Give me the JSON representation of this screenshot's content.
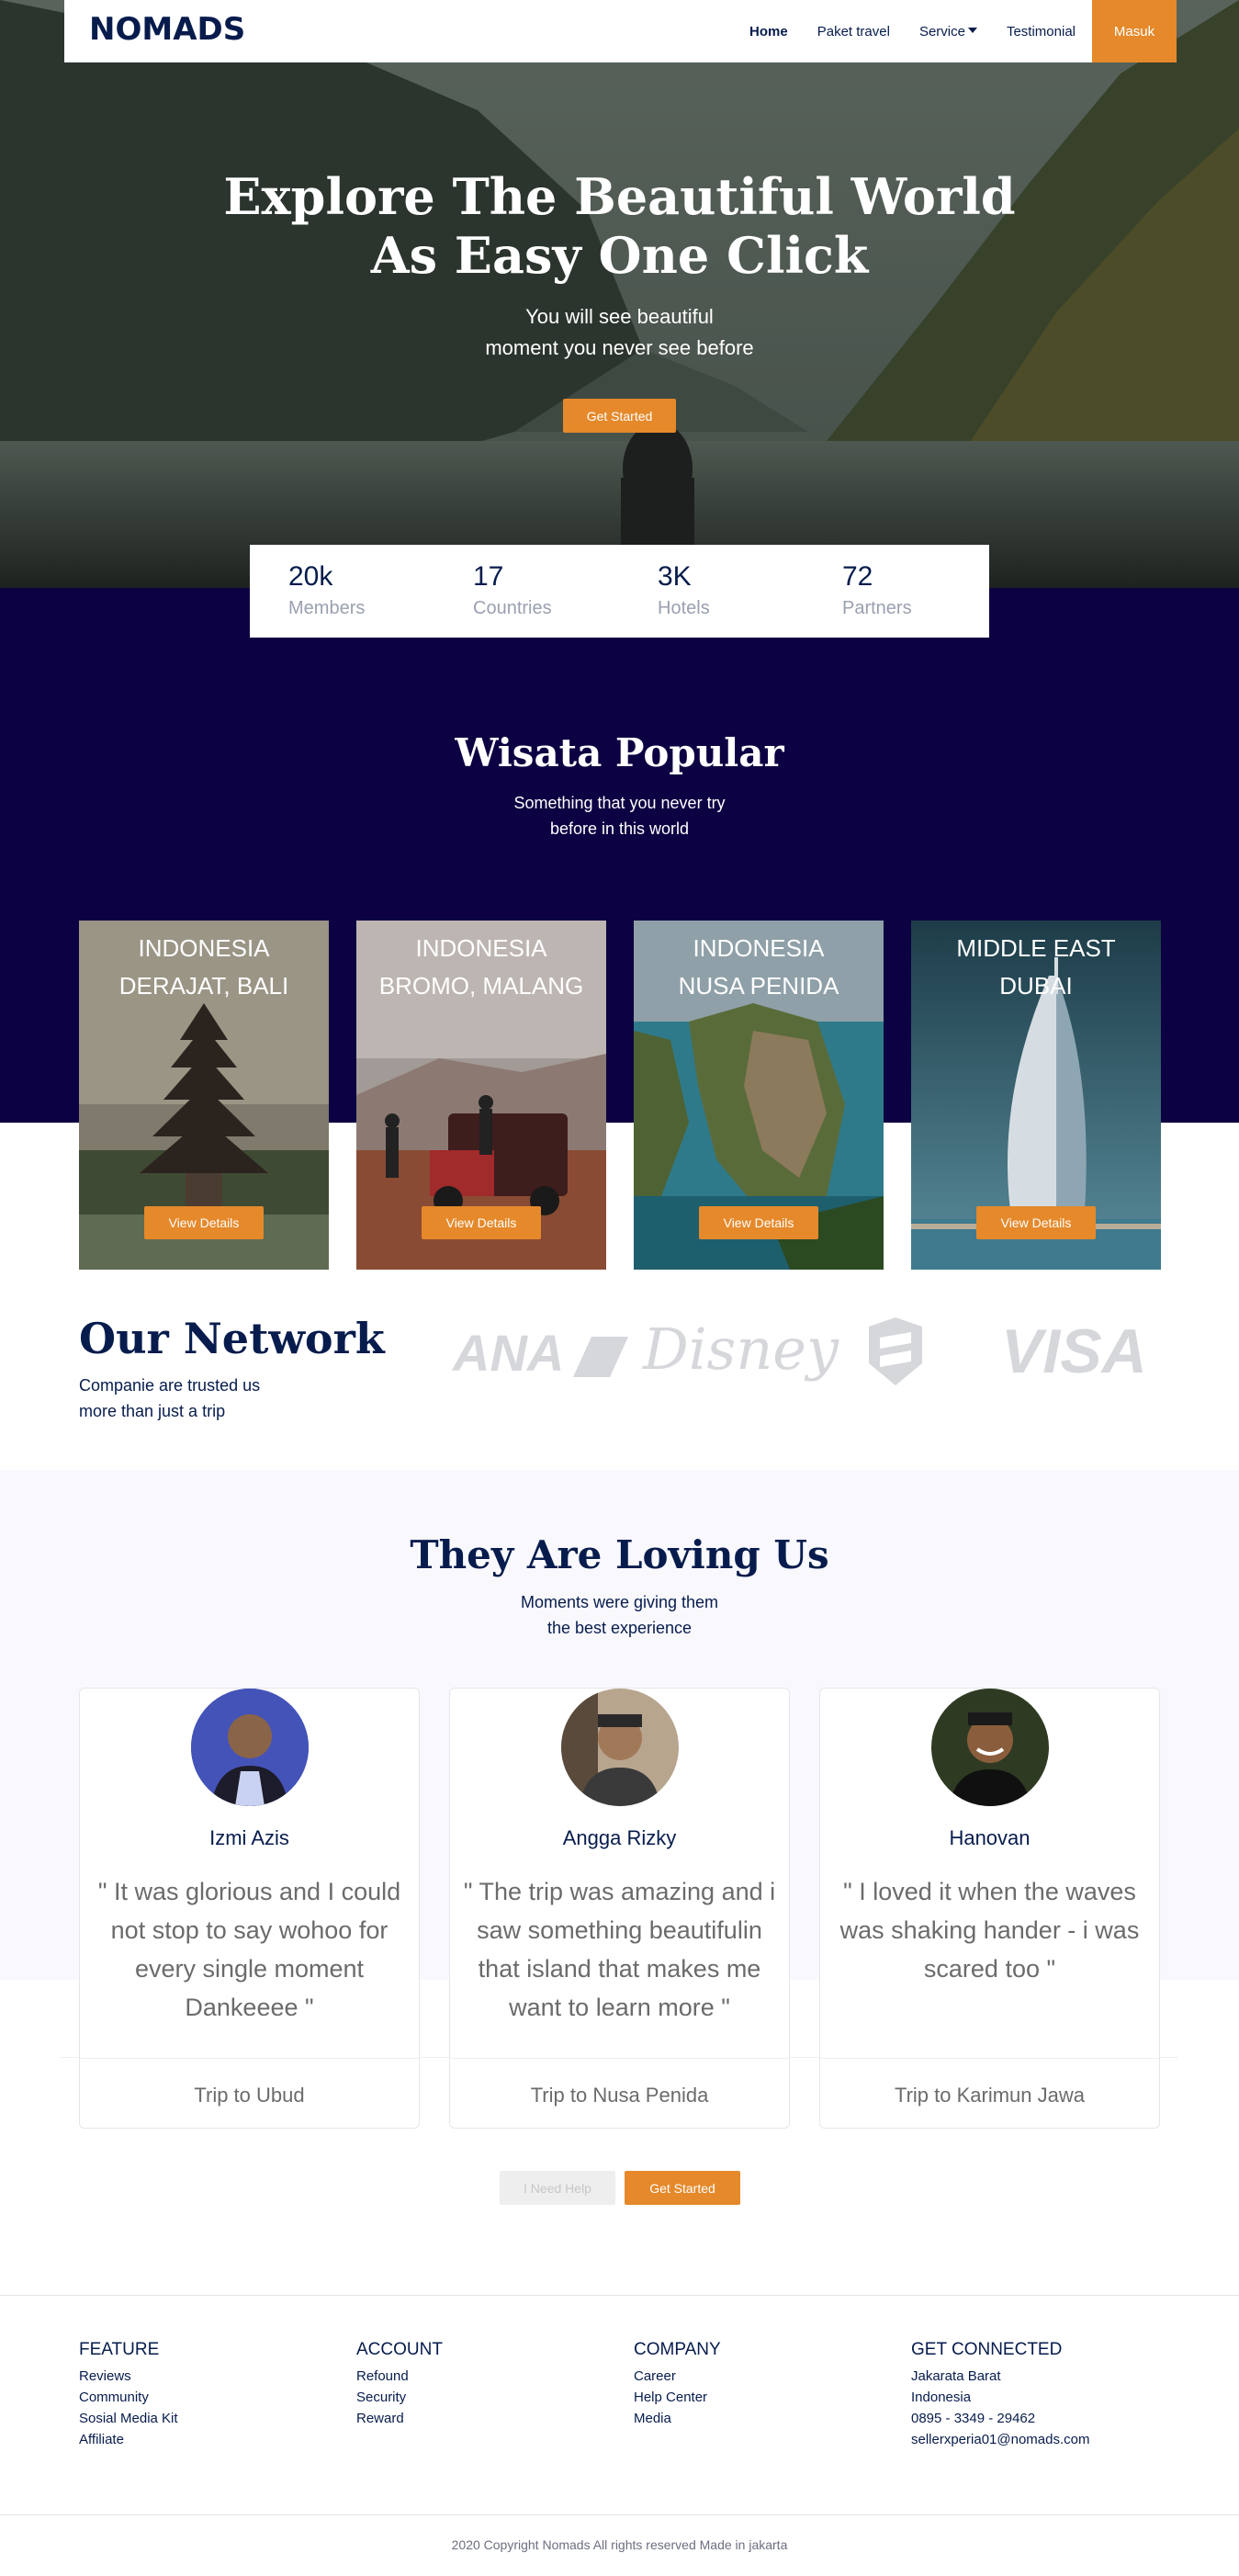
{
  "nav": {
    "logo": "NOMADS",
    "links": [
      "Home",
      "Paket travel",
      "Service",
      "Testimonial"
    ],
    "login_label": "Masuk"
  },
  "hero": {
    "title_line1": "Explore The Beautiful World",
    "title_line2": "As Easy One Click",
    "subtitle_line1": "You will see beautiful",
    "subtitle_line2": "moment you never see before",
    "cta_label": "Get Started"
  },
  "stats": [
    {
      "value": "20k",
      "label": "Members"
    },
    {
      "value": "17",
      "label": "Countries"
    },
    {
      "value": "3K",
      "label": "Hotels"
    },
    {
      "value": "72",
      "label": "Partners"
    }
  ],
  "popular": {
    "title": "Wisata Popular",
    "subtitle_line1": "Something that you never try",
    "subtitle_line2": "before in this world",
    "cards": [
      {
        "country": "INDONESIA",
        "place": "DERAJAT, BALI",
        "button": "View Details"
      },
      {
        "country": "INDONESIA",
        "place": "BROMO, MALANG",
        "button": "View Details"
      },
      {
        "country": "INDONESIA",
        "place": "NUSA PENIDA",
        "button": "View Details"
      },
      {
        "country": "MIDDLE EAST",
        "place": "DUBAI",
        "button": "View Details"
      }
    ]
  },
  "network": {
    "title": "Our Network",
    "subtitle_line1": "Companie are trusted us",
    "subtitle_line2": "more than just a trip",
    "partners": [
      "ANA",
      "Disney",
      "VISA"
    ]
  },
  "testimonials": {
    "title": "They Are Loving Us",
    "subtitle_line1": "Moments were giving them",
    "subtitle_line2": "the best experience",
    "items": [
      {
        "name": "Izmi Azis",
        "quote": "\" It was glorious and I could not stop to say wohoo for every single moment Dankeeee \"",
        "trip": "Trip to Ubud"
      },
      {
        "name": "Angga Rizky",
        "quote": "\" The trip was amazing and i saw something beautifulin that island that makes me want to learn more \"",
        "trip": "Trip to Nusa Penida"
      },
      {
        "name": "Hanovan",
        "quote": "\" I loved it when the waves was shaking hander - i was scared too \"",
        "trip": "Trip to Karimun Jawa"
      }
    ],
    "help_label": "I Need Help",
    "start_label": "Get Started"
  },
  "footer": {
    "columns": [
      {
        "title": "FEATURE",
        "items": [
          "Reviews",
          "Community",
          "Sosial Media Kit",
          "Affiliate"
        ]
      },
      {
        "title": "ACCOUNT",
        "items": [
          "Refound",
          "Security",
          "Reward"
        ]
      },
      {
        "title": "COMPANY",
        "items": [
          "Career",
          "Help Center",
          "Media"
        ]
      },
      {
        "title": "GET CONNECTED",
        "items": [
          "Jakarata Barat",
          "Indonesia",
          "0895 - 3349 - 29462",
          "sellerxperia01@nomads.com"
        ]
      }
    ],
    "copyright": "2020 Copyright Nomads All rights reserved Made in jakarta"
  },
  "colors": {
    "primary": "#071c4d",
    "accent": "#e5892b",
    "popular_bg": "#0c0142"
  }
}
